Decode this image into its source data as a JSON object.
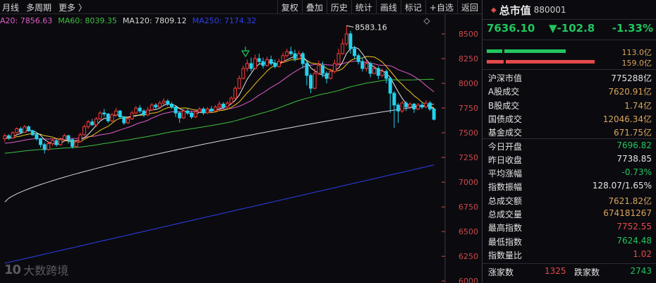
{
  "toolbar": {
    "left": [
      "月线",
      "多周期",
      "更多 〉"
    ],
    "right": [
      "复权",
      "叠加",
      "历史",
      "统计",
      "画线",
      "标记",
      "+自选",
      "返回"
    ]
  },
  "ma_legend": [
    {
      "text": "A20: 7856.63",
      "color": "#e05cc8"
    },
    {
      "text": "MA60: 8039.35",
      "color": "#3fbf3f"
    },
    {
      "text": "MA120: 7809.12",
      "color": "#d8d8d8"
    },
    {
      "text": "MA250: 7174.32",
      "color": "#2f3ef0"
    }
  ],
  "chart_data": {
    "type": "candlestick",
    "title": "",
    "y_ticks": [
      8500,
      8250,
      8000,
      7750,
      7500,
      7250,
      7000,
      6750,
      6500,
      6250,
      6000
    ],
    "ylim": [
      5980,
      8700
    ],
    "high_annotation": "8583.16",
    "up_color": "#ff3b3b",
    "down_color": "#22d3ee",
    "candles": [
      [
        7440,
        7470,
        7410,
        7490
      ],
      [
        7470,
        7445,
        7430,
        7485
      ],
      [
        7445,
        7500,
        7440,
        7515
      ],
      [
        7500,
        7540,
        7490,
        7555
      ],
      [
        7540,
        7505,
        7495,
        7560
      ],
      [
        7505,
        7560,
        7500,
        7580
      ],
      [
        7560,
        7520,
        7510,
        7575
      ],
      [
        7520,
        7480,
        7470,
        7530
      ],
      [
        7480,
        7440,
        7420,
        7495
      ],
      [
        7440,
        7380,
        7350,
        7450
      ],
      [
        7380,
        7330,
        7290,
        7400
      ],
      [
        7330,
        7390,
        7320,
        7410
      ],
      [
        7390,
        7420,
        7370,
        7440
      ],
      [
        7420,
        7380,
        7360,
        7435
      ],
      [
        7380,
        7430,
        7370,
        7450
      ],
      [
        7430,
        7470,
        7420,
        7490
      ],
      [
        7470,
        7430,
        7390,
        7480
      ],
      [
        7430,
        7360,
        7340,
        7440
      ],
      [
        7360,
        7410,
        7350,
        7430
      ],
      [
        7410,
        7480,
        7400,
        7500
      ],
      [
        7480,
        7560,
        7470,
        7580
      ],
      [
        7560,
        7610,
        7540,
        7630
      ],
      [
        7610,
        7580,
        7570,
        7640
      ],
      [
        7580,
        7640,
        7560,
        7660
      ],
      [
        7640,
        7700,
        7630,
        7720
      ],
      [
        7700,
        7690,
        7660,
        7740
      ],
      [
        7690,
        7620,
        7600,
        7700
      ],
      [
        7620,
        7680,
        7610,
        7700
      ],
      [
        7680,
        7720,
        7660,
        7750
      ],
      [
        7720,
        7660,
        7640,
        7730
      ],
      [
        7660,
        7600,
        7580,
        7670
      ],
      [
        7600,
        7640,
        7590,
        7660
      ],
      [
        7640,
        7700,
        7630,
        7720
      ],
      [
        7700,
        7750,
        7690,
        7770
      ],
      [
        7750,
        7720,
        7700,
        7780
      ],
      [
        7720,
        7680,
        7660,
        7740
      ],
      [
        7680,
        7730,
        7670,
        7760
      ],
      [
        7730,
        7780,
        7720,
        7800
      ],
      [
        7780,
        7760,
        7730,
        7800
      ],
      [
        7760,
        7800,
        7740,
        7820
      ],
      [
        7800,
        7820,
        7780,
        7850
      ],
      [
        7820,
        7790,
        7770,
        7840
      ],
      [
        7790,
        7760,
        7740,
        7810
      ],
      [
        7760,
        7700,
        7660,
        7770
      ],
      [
        7700,
        7650,
        7600,
        7710
      ],
      [
        7650,
        7720,
        7640,
        7740
      ],
      [
        7720,
        7700,
        7680,
        7750
      ],
      [
        7700,
        7660,
        7640,
        7720
      ],
      [
        7660,
        7710,
        7650,
        7730
      ],
      [
        7710,
        7740,
        7700,
        7760
      ],
      [
        7740,
        7700,
        7680,
        7760
      ],
      [
        7700,
        7740,
        7690,
        7760
      ],
      [
        7740,
        7720,
        7700,
        7770
      ],
      [
        7720,
        7760,
        7710,
        7780
      ],
      [
        7760,
        7790,
        7740,
        7820
      ],
      [
        7790,
        7760,
        7740,
        7810
      ],
      [
        7760,
        7800,
        7750,
        7820
      ],
      [
        7800,
        7850,
        7790,
        7870
      ],
      [
        7850,
        7950,
        7840,
        7970
      ],
      [
        7950,
        8050,
        7940,
        8080
      ],
      [
        8050,
        8150,
        8040,
        8180
      ],
      [
        8150,
        8200,
        8120,
        8240
      ],
      [
        8200,
        8150,
        8120,
        8260
      ],
      [
        8150,
        8250,
        8140,
        8290
      ],
      [
        8250,
        8220,
        8190,
        8300
      ],
      [
        8220,
        8180,
        8150,
        8260
      ],
      [
        8180,
        8240,
        8170,
        8270
      ],
      [
        8240,
        8200,
        8180,
        8280
      ],
      [
        8200,
        8170,
        8150,
        8240
      ],
      [
        8170,
        8220,
        8160,
        8250
      ],
      [
        8220,
        8280,
        8210,
        8310
      ],
      [
        8280,
        8320,
        8260,
        8350
      ],
      [
        8320,
        8300,
        8280,
        8370
      ],
      [
        8300,
        8250,
        8220,
        8340
      ],
      [
        8250,
        8300,
        8240,
        8330
      ],
      [
        8300,
        8200,
        8150,
        8320
      ],
      [
        8200,
        8080,
        7980,
        8220
      ],
      [
        8080,
        7950,
        7900,
        8100
      ],
      [
        7950,
        8100,
        7940,
        8150
      ],
      [
        8100,
        8180,
        8080,
        8230
      ],
      [
        8180,
        8100,
        8060,
        8220
      ],
      [
        8100,
        8050,
        8000,
        8120
      ],
      [
        8050,
        8120,
        8040,
        8150
      ],
      [
        8120,
        8200,
        8100,
        8240
      ],
      [
        8200,
        8300,
        8190,
        8350
      ],
      [
        8300,
        8400,
        8290,
        8450
      ],
      [
        8400,
        8500,
        8380,
        8583
      ],
      [
        8500,
        8350,
        8300,
        8530
      ],
      [
        8350,
        8280,
        8250,
        8380
      ],
      [
        8280,
        8220,
        8190,
        8300
      ],
      [
        8220,
        8150,
        8120,
        8260
      ],
      [
        8150,
        8200,
        8120,
        8230
      ],
      [
        8200,
        8100,
        8060,
        8220
      ],
      [
        8100,
        8150,
        8090,
        8180
      ],
      [
        8150,
        8080,
        8040,
        8170
      ],
      [
        8080,
        8120,
        8060,
        8150
      ],
      [
        8120,
        8050,
        8000,
        8140
      ],
      [
        8050,
        7900,
        7700,
        8060
      ],
      [
        7900,
        7780,
        7550,
        7920
      ],
      [
        7780,
        7720,
        7600,
        7800
      ],
      [
        7720,
        7800,
        7700,
        7820
      ],
      [
        7800,
        7760,
        7720,
        7820
      ],
      [
        7760,
        7790,
        7740,
        7810
      ],
      [
        7790,
        7740,
        7700,
        7800
      ],
      [
        7740,
        7780,
        7730,
        7800
      ],
      [
        7780,
        7760,
        7740,
        7810
      ],
      [
        7760,
        7800,
        7750,
        7830
      ],
      [
        7800,
        7740,
        7720,
        7820
      ],
      [
        7740,
        7636,
        7624,
        7752
      ]
    ],
    "ma_lines": [
      {
        "name": "MA5",
        "color": "#e8e8e8",
        "values": "ma5"
      },
      {
        "name": "MA10",
        "color": "#f0c419",
        "values": "ma10"
      },
      {
        "name": "MA20",
        "color": "#e05cc8",
        "values": "ma20"
      },
      {
        "name": "MA60",
        "color": "#3fbf3f",
        "values": "ma60"
      },
      {
        "name": "MA120",
        "color": "#d8d8d8",
        "values": "ma120"
      },
      {
        "name": "MA250",
        "color": "#2f3ef0",
        "values": "ma250"
      }
    ]
  },
  "right": {
    "title": "总市值",
    "code": "880001",
    "price": "7636.10",
    "change": "▼-102.8",
    "pct": "-1.33%",
    "bars": [
      {
        "fill": 0.62,
        "color": "#22c55e",
        "value": "113.0亿"
      },
      {
        "fill": 0.85,
        "color": "#e34a4a",
        "value": "159.0亿"
      }
    ],
    "stats": [
      {
        "label": "沪深市值",
        "value": "775288亿",
        "cls": "c-white"
      },
      {
        "label": "A股成交",
        "value": "7620.91亿",
        "cls": "c-gold"
      },
      {
        "label": "B股成交",
        "value": "1.74亿",
        "cls": "c-gold"
      },
      {
        "label": "国债成交",
        "value": "12046.34亿",
        "cls": "c-gold"
      },
      {
        "label": "基金成交",
        "value": "671.75亿",
        "cls": "c-gold"
      },
      {
        "label": "今日开盘",
        "value": "7696.82",
        "cls": "c-green"
      },
      {
        "label": "昨日收盘",
        "value": "7738.85",
        "cls": "c-white"
      },
      {
        "label": "平均涨幅",
        "value": "-0.73%",
        "cls": "c-green"
      },
      {
        "label": "指数振幅",
        "value": "128.07/1.65%",
        "cls": "c-white"
      },
      {
        "label": "总成交额",
        "value": "7621.82亿",
        "cls": "c-gold"
      },
      {
        "label": "总成交量",
        "value": "674181267",
        "cls": "c-gold"
      },
      {
        "label": "最高指数",
        "value": "7752.55",
        "cls": "c-red"
      },
      {
        "label": "最低指数",
        "value": "7624.48",
        "cls": "c-green"
      },
      {
        "label": "指数量比",
        "value": "1.02",
        "cls": "c-red"
      }
    ],
    "up_label": "涨家数",
    "up_count": "1325",
    "down_label": "跌家数",
    "down_count": "2743"
  },
  "watermark": {
    "logo": "10",
    "text": "大数跨境"
  }
}
